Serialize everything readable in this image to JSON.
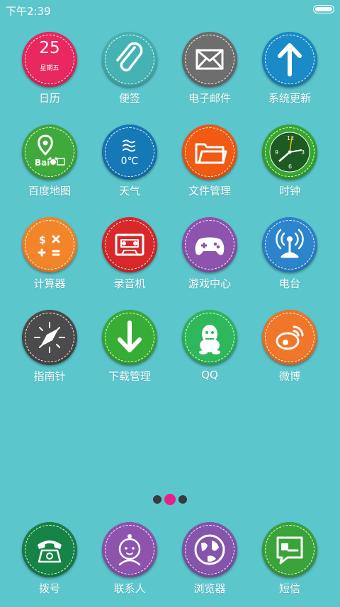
{
  "status": {
    "time": "下午2:39",
    "battery_fraction": 1.0
  },
  "apps": [
    {
      "id": "calendar",
      "label": "日历",
      "color": "#e8285f",
      "icon": "calendar-icon",
      "day": "25",
      "weekday": "星期五"
    },
    {
      "id": "notes",
      "label": "便签",
      "color": "#45b3b3",
      "icon": "paperclip-icon"
    },
    {
      "id": "email",
      "label": "电子邮件",
      "color": "#6e6e6e",
      "icon": "envelope-icon"
    },
    {
      "id": "system-update",
      "label": "系统更新",
      "color": "#1a8bc7",
      "icon": "arrow-up-icon"
    },
    {
      "id": "baidu-map",
      "label": "百度地图",
      "color": "#3fa93c",
      "icon": "baidu-map-icon"
    },
    {
      "id": "weather",
      "label": "天气",
      "color": "#1578b7",
      "icon": "weather-icon",
      "temperature": "0℃"
    },
    {
      "id": "file-manager",
      "label": "文件管理",
      "color": "#f05a12",
      "icon": "folder-icon"
    },
    {
      "id": "clock",
      "label": "时钟",
      "color": "#36a82e",
      "icon": "clock-icon"
    },
    {
      "id": "calculator",
      "label": "计算器",
      "color": "#f2852a",
      "icon": "calculator-icon"
    },
    {
      "id": "recorder",
      "label": "录音机",
      "color": "#d8282a",
      "icon": "cassette-icon"
    },
    {
      "id": "game-center",
      "label": "游戏中心",
      "color": "#8e54ad",
      "icon": "gamepad-icon"
    },
    {
      "id": "radio",
      "label": "电台",
      "color": "#2c84cc",
      "icon": "radio-tower-icon"
    },
    {
      "id": "compass",
      "label": "指南针",
      "color": "#4b4b4b",
      "icon": "compass-icon"
    },
    {
      "id": "download-manager",
      "label": "下载管理",
      "color": "#38ad36",
      "icon": "download-arrow-icon"
    },
    {
      "id": "qq",
      "label": "QQ",
      "color": "#2fb85b",
      "icon": "qq-penguin-icon"
    },
    {
      "id": "weibo",
      "label": "微博",
      "color": "#f0762a",
      "icon": "weibo-icon"
    }
  ],
  "pager": {
    "count": 3,
    "active": 1,
    "active_color": "#e4218a",
    "inactive_color": "#3a3a3a"
  },
  "dock": [
    {
      "id": "dialer",
      "label": "拨号",
      "color": "#168446",
      "icon": "telephone-icon"
    },
    {
      "id": "contacts",
      "label": "联系人",
      "color": "#8e54ad",
      "icon": "person-icon"
    },
    {
      "id": "browser",
      "label": "浏览器",
      "color": "#8455ab",
      "icon": "globe-icon"
    },
    {
      "id": "messages",
      "label": "短信",
      "color": "#3aa43a",
      "icon": "message-icon"
    }
  ]
}
